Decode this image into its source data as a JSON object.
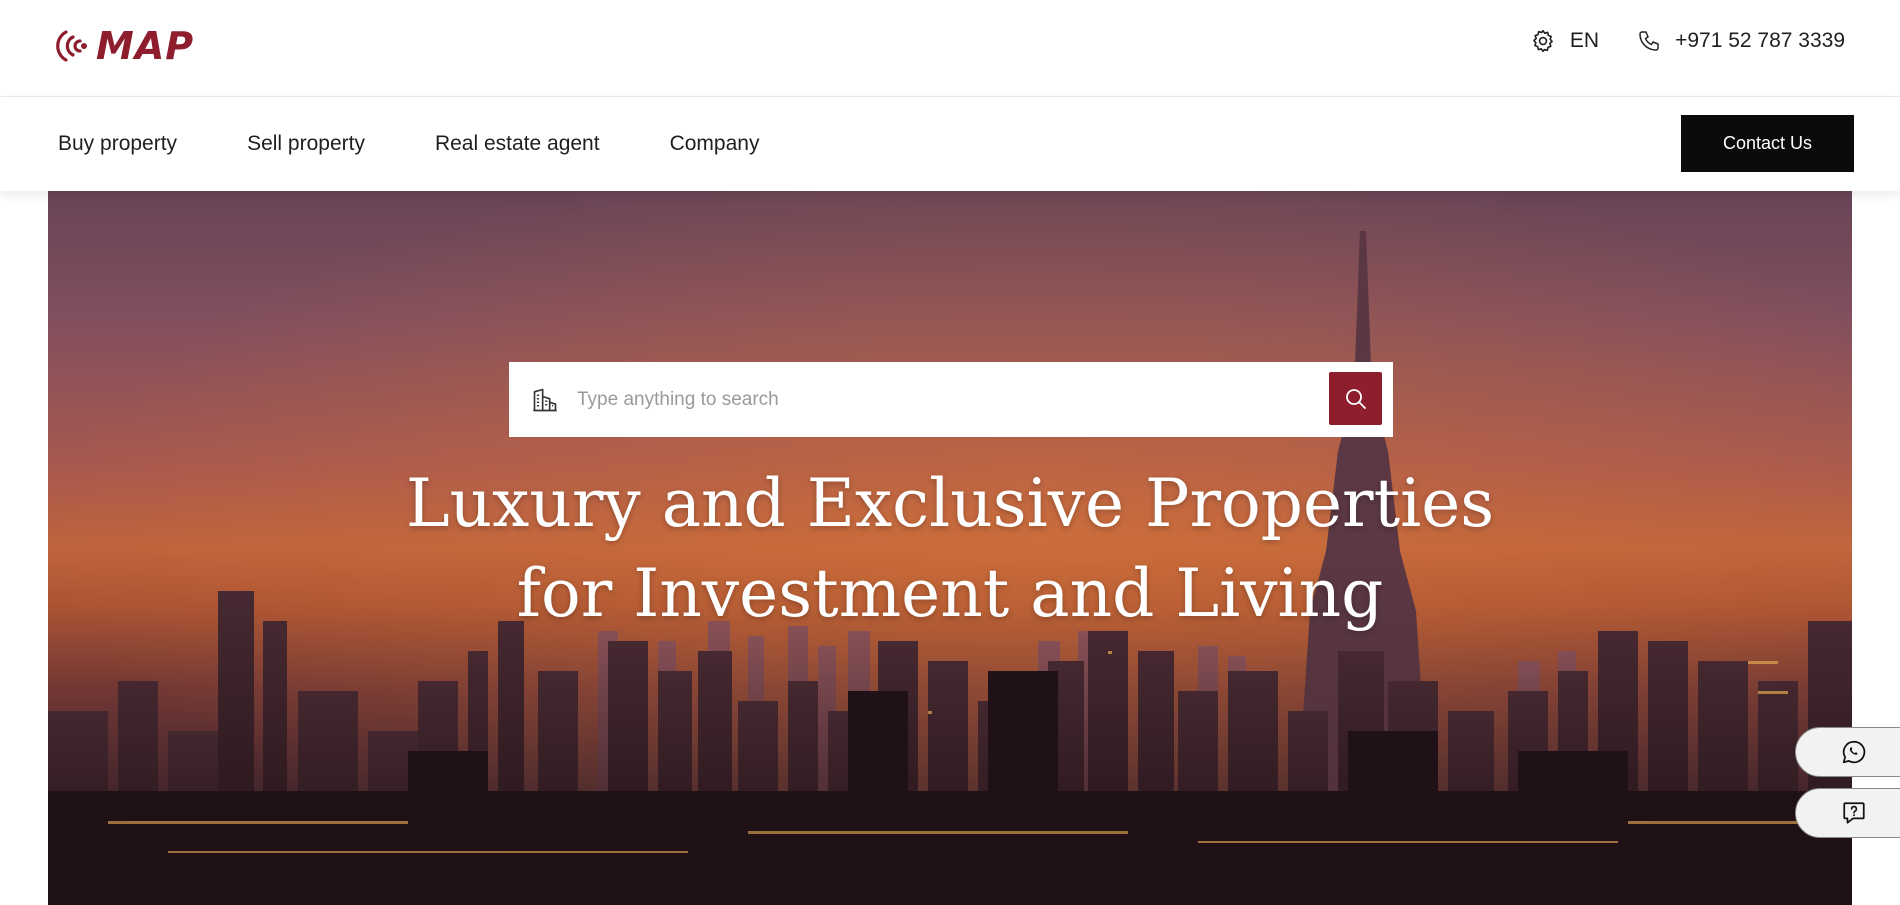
{
  "brand": {
    "name": "MAP",
    "color": "#8e1e2e"
  },
  "header": {
    "language": "EN",
    "phone": "+971 52 787 3339"
  },
  "nav": {
    "items": [
      "Buy property",
      "Sell property",
      "Real estate agent",
      "Company"
    ],
    "contact_label": "Contact Us"
  },
  "search": {
    "placeholder": "Type anything to search"
  },
  "hero": {
    "line1": "Luxury and Exclusive Properties",
    "line2": "for Investment and Living"
  },
  "icons": {
    "settings": "gear-icon",
    "phone": "phone-icon",
    "building": "building-icon",
    "search": "search-icon",
    "whatsapp": "whatsapp-icon",
    "help": "help-chat-icon"
  }
}
